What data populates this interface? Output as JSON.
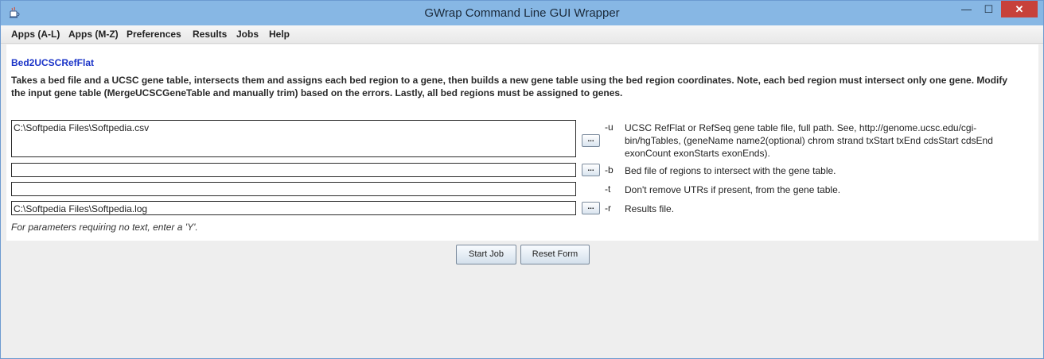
{
  "window": {
    "title": "GWrap Command Line GUI Wrapper",
    "controls": {
      "minimize": "—",
      "maximize": "☐",
      "close": "✕"
    }
  },
  "menu": [
    "Apps (A-L)",
    "Apps (M-Z)",
    "Preferences",
    "Results",
    "Jobs",
    "Help"
  ],
  "app": {
    "name": "Bed2UCSCRefFlat",
    "description": "Takes a bed file and a UCSC gene table, intersects them and assigns each bed region to a gene, then builds a new gene table using the bed region coordinates. Note, each bed region must intersect only one gene. Modify the input gene table (MergeUCSCGeneTable and manually trim) based on the errors. Lastly, all bed regions must be assigned to genes."
  },
  "params": [
    {
      "value": "C:\\Softpedia Files\\Softpedia.csv",
      "flag": "-u",
      "browse": "...",
      "description": "UCSC RefFlat or RefSeq gene table file, full path. See, http://genome.ucsc.edu/cgi-bin/hgTables, (geneName name2(optional) chrom strand txStart txEnd cdsStart cdsEnd exonCount exonStarts exonEnds)."
    },
    {
      "value": "",
      "flag": "-b",
      "browse": "...",
      "description": "Bed file of regions to intersect with the gene table."
    },
    {
      "value": "",
      "flag": "-t",
      "browse": null,
      "description": "Don't remove UTRs if present, from the gene table."
    },
    {
      "value": "C:\\Softpedia Files\\Softpedia.log",
      "flag": "-r",
      "browse": "...",
      "description": "Results file."
    }
  ],
  "note": "For parameters requiring no text, enter a 'Y'.",
  "buttons": {
    "start": "Start Job",
    "reset": "Reset Form"
  },
  "colors": {
    "titlebar": "#87b7e4",
    "app_name": "#1b34c8",
    "close_button": "#c7413a"
  },
  "icons": {
    "app": "java-coffee-cup-icon"
  }
}
